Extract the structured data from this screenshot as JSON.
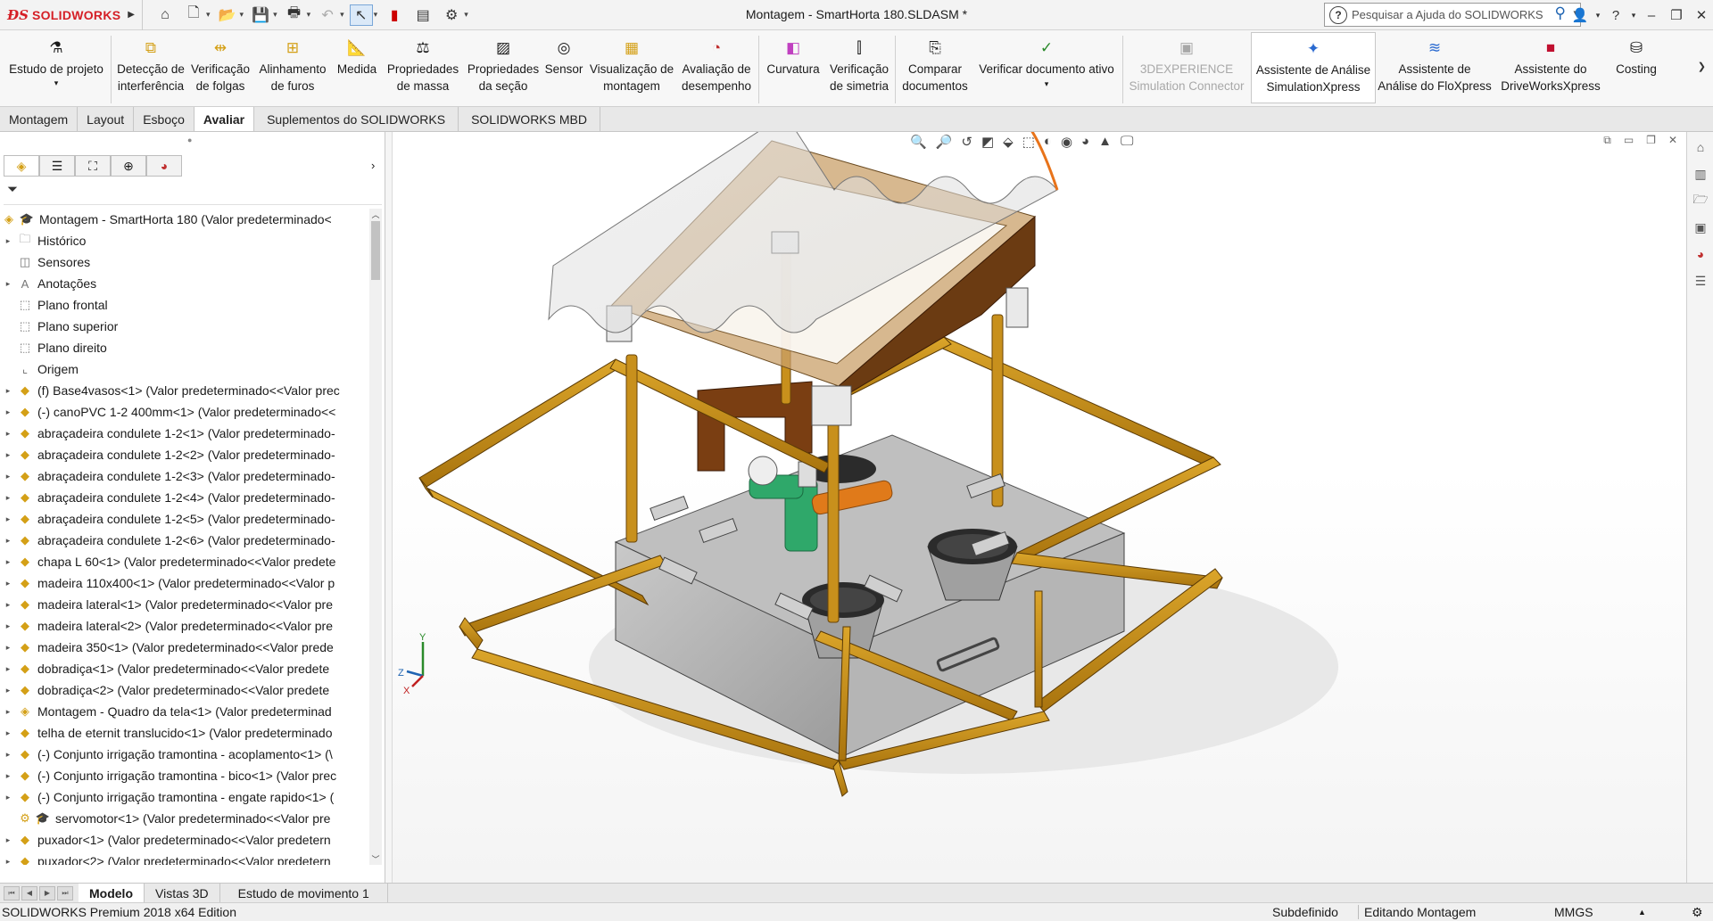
{
  "titlebar": {
    "brand": "SOLIDWORKS",
    "title": "Montagem - SmartHorta 180.SLDASM *",
    "search_placeholder": "Pesquisar a Ajuda do SOLIDWORKS"
  },
  "commands": [
    {
      "label": "Estudo de projeto"
    },
    {
      "label": "Detecção de interferência"
    },
    {
      "label": "Verificação de folgas"
    },
    {
      "label": "Alinhamento de furos"
    },
    {
      "label": "Medida"
    },
    {
      "label": "Propriedades de massa"
    },
    {
      "label": "Propriedades da seção"
    },
    {
      "label": "Sensor"
    },
    {
      "label": "Visualização de montagem"
    },
    {
      "label": "Avaliação de desempenho"
    },
    {
      "label": "Curvatura"
    },
    {
      "label": "Verificação de simetria"
    },
    {
      "label": "Comparar documentos"
    },
    {
      "label": "Verificar documento ativo"
    },
    {
      "label": "3DEXPERIENCE Simulation Connector"
    },
    {
      "label": "Assistente de Análise SimulationXpress"
    },
    {
      "label": "Assistente de Análise do FloXpress"
    },
    {
      "label": "Assistente do DriveWorksXpress"
    },
    {
      "label": "Costing"
    }
  ],
  "tabs": [
    "Montagem",
    "Layout",
    "Esboço",
    "Avaliar",
    "Suplementos do SOLIDWORKS",
    "SOLIDWORKS MBD"
  ],
  "tree": [
    "Montagem - SmartHorta 180  (Valor predeterminado<",
    "Histórico",
    "Sensores",
    "Anotações",
    "Plano frontal",
    "Plano superior",
    "Plano direito",
    "Origem",
    "(f) Base4vasos<1> (Valor predeterminado<<Valor prec",
    "(-) canoPVC 1-2 400mm<1> (Valor predeterminado<<",
    "abraçadeira condulete 1-2<1> (Valor predeterminado-",
    "abraçadeira condulete 1-2<2> (Valor predeterminado-",
    "abraçadeira condulete 1-2<3> (Valor predeterminado-",
    "abraçadeira condulete 1-2<4> (Valor predeterminado-",
    "abraçadeira condulete 1-2<5> (Valor predeterminado-",
    "abraçadeira condulete 1-2<6> (Valor predeterminado-",
    "chapa L 60<1> (Valor predeterminado<<Valor predete",
    "madeira 110x400<1> (Valor predeterminado<<Valor p",
    "madeira lateral<1> (Valor predeterminado<<Valor pre",
    "madeira lateral<2> (Valor predeterminado<<Valor pre",
    "madeira 350<1> (Valor predeterminado<<Valor prede",
    "dobradiça<1> (Valor predeterminado<<Valor predete",
    "dobradiça<2> (Valor predeterminado<<Valor predete",
    "Montagem - Quadro da tela<1> (Valor predeterminad",
    "telha de eternit translucido<1> (Valor predeterminado",
    "(-) Conjunto irrigação tramontina - acoplamento<1> (\\",
    "(-) Conjunto irrigação tramontina - bico<1> (Valor prec",
    "(-) Conjunto irrigação tramontina - engate rapido<1> (",
    "servomotor<1> (Valor predeterminado<<Valor pre",
    "puxador<1> (Valor predeterminado<<Valor predetern",
    "puxador<2> (Valor predeterminado<<Valor predetern"
  ],
  "bottom_tabs": [
    "Modelo",
    "Vistas 3D",
    "Estudo de movimento 1"
  ],
  "status": {
    "edition": "SOLIDWORKS Premium 2018 x64 Edition",
    "definition": "Subdefinido",
    "mode": "Editando Montagem",
    "units": "MMGS"
  },
  "triad": {
    "x": "X",
    "y": "Y",
    "z": "Z"
  },
  "colors": {
    "wood": "#c8901c",
    "brand": "#d51f26",
    "pipe_green": "#2fa86a",
    "pipe_orange": "#e07a1a"
  }
}
